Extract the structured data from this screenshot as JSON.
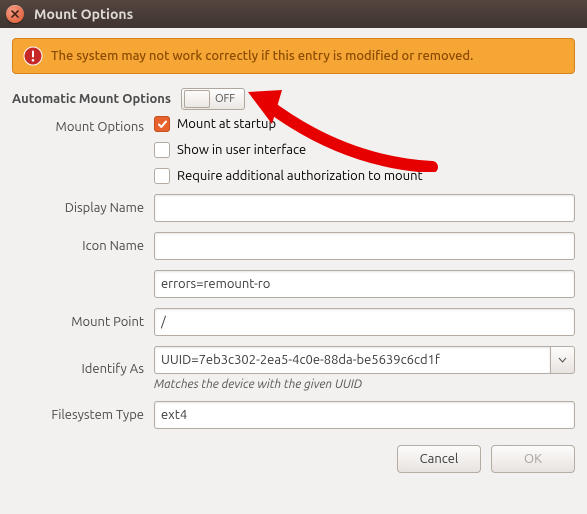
{
  "titlebar": {
    "title": "Mount Options"
  },
  "warning": {
    "text": "The system may not work correctly if this entry is modified or removed."
  },
  "auto": {
    "label": "Automatic Mount Options",
    "state": "OFF"
  },
  "labels": {
    "mount_options": "Mount Options",
    "display_name": "Display Name",
    "icon_name": "Icon Name",
    "mount_point": "Mount Point",
    "identify_as": "Identify As",
    "filesystem_type": "Filesystem Type"
  },
  "checks": {
    "startup": "Mount at startup",
    "show_ui": "Show in user interface",
    "require_auth": "Require additional authorization to mount"
  },
  "fields": {
    "display_name": "",
    "icon_name": "",
    "opts_line": "errors=remount-ro",
    "mount_point": "/",
    "identify_as": "UUID=7eb3c302-2ea5-4c0e-88da-be5639c6cd1f",
    "identify_hint": "Matches the device with the given UUID",
    "fs_type": "ext4"
  },
  "actions": {
    "cancel": "Cancel",
    "ok": "OK"
  }
}
